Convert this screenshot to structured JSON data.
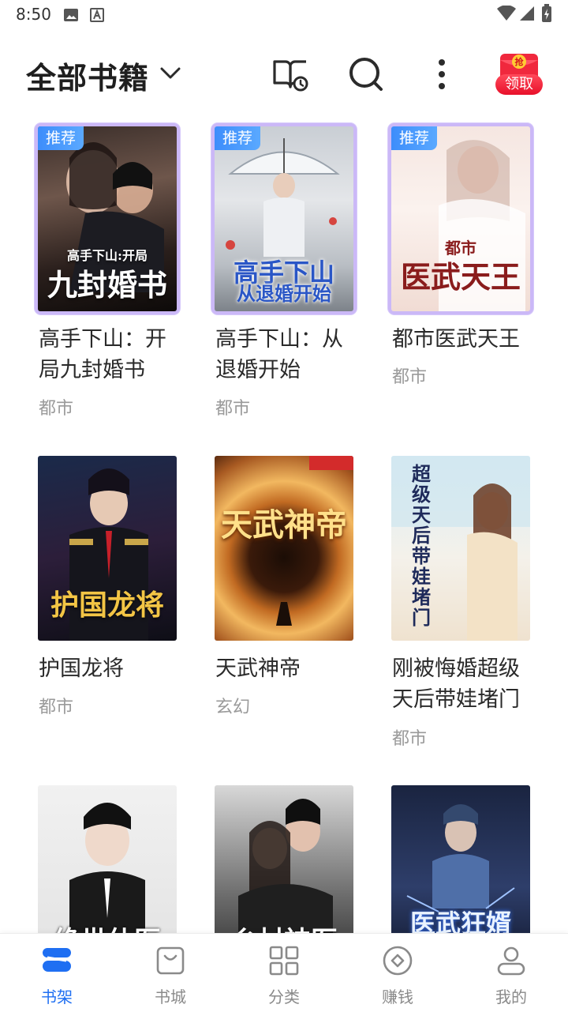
{
  "status_bar": {
    "time": "8:50"
  },
  "header": {
    "title": "全部书籍",
    "redpacket_label": "领取",
    "redpacket_badge": "抢"
  },
  "books": [
    {
      "name": "高手下山：开局九封婚书",
      "category": "都市",
      "recommended": true,
      "badge": "推荐",
      "cover_text": "九封婚书",
      "cover_sub": "高手下山:开局"
    },
    {
      "name": "高手下山：从退婚开始",
      "category": "都市",
      "recommended": true,
      "badge": "推荐",
      "cover_text": "高手下山",
      "cover_sub": "从退婚开始"
    },
    {
      "name": "都市医武天王",
      "category": "都市",
      "recommended": true,
      "badge": "推荐",
      "cover_text": "医武天王",
      "cover_sub": "都市"
    },
    {
      "name": "护国龙将",
      "category": "都市",
      "recommended": false,
      "cover_text": "护国龙将",
      "cover_sub": ""
    },
    {
      "name": "天武神帝",
      "category": "玄幻",
      "recommended": false,
      "cover_text": "天武神帝",
      "cover_sub": ""
    },
    {
      "name": "刚被悔婚超级天后带娃堵门",
      "category": "都市",
      "recommended": false,
      "cover_text": "超级天后带娃堵门",
      "cover_sub": ""
    },
    {
      "name": "",
      "category": "",
      "recommended": false,
      "cover_text": "绝世仙医",
      "cover_sub": ""
    },
    {
      "name": "",
      "category": "",
      "recommended": false,
      "cover_text": "乡村神医",
      "cover_sub": ""
    },
    {
      "name": "",
      "category": "",
      "recommended": false,
      "cover_text": "医武狂婿",
      "cover_sub": ""
    }
  ],
  "bottom_nav": [
    {
      "label": "书架",
      "icon": "bookshelf-icon",
      "active": true
    },
    {
      "label": "书城",
      "icon": "store-bag-icon",
      "active": false
    },
    {
      "label": "分类",
      "icon": "grid-icon",
      "active": false
    },
    {
      "label": "赚钱",
      "icon": "coin-icon",
      "active": false
    },
    {
      "label": "我的",
      "icon": "profile-icon",
      "active": false
    }
  ],
  "colors": {
    "accent": "#1f6ff2",
    "badge": "#3d8dfb",
    "recommend_frame": "#cbb8f7"
  }
}
